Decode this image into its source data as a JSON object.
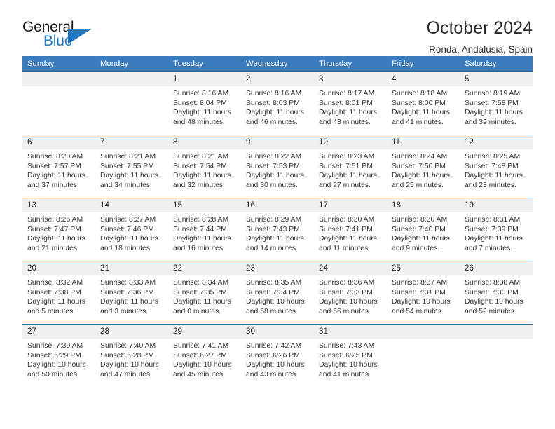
{
  "logo": {
    "word_top": "General",
    "word_bottom": "Blue",
    "triangle_icon": "triangle-icon",
    "accent_color": "#1f78c1"
  },
  "header": {
    "title": "October 2024",
    "subtitle": "Ronda, Andalusia, Spain"
  },
  "theme": {
    "header_blue": "#3a7cbe",
    "border_blue": "#2e6da4",
    "daynum_bg": "#f0f0f0"
  },
  "weekday_headers": [
    "Sunday",
    "Monday",
    "Tuesday",
    "Wednesday",
    "Thursday",
    "Friday",
    "Saturday"
  ],
  "weeks": [
    [
      {
        "day": "",
        "sunrise": "",
        "sunset": "",
        "daylight_line1": "",
        "daylight_line2": ""
      },
      {
        "day": "",
        "sunrise": "",
        "sunset": "",
        "daylight_line1": "",
        "daylight_line2": ""
      },
      {
        "day": "1",
        "sunrise": "Sunrise: 8:16 AM",
        "sunset": "Sunset: 8:04 PM",
        "daylight_line1": "Daylight: 11 hours",
        "daylight_line2": "and 48 minutes."
      },
      {
        "day": "2",
        "sunrise": "Sunrise: 8:16 AM",
        "sunset": "Sunset: 8:03 PM",
        "daylight_line1": "Daylight: 11 hours",
        "daylight_line2": "and 46 minutes."
      },
      {
        "day": "3",
        "sunrise": "Sunrise: 8:17 AM",
        "sunset": "Sunset: 8:01 PM",
        "daylight_line1": "Daylight: 11 hours",
        "daylight_line2": "and 43 minutes."
      },
      {
        "day": "4",
        "sunrise": "Sunrise: 8:18 AM",
        "sunset": "Sunset: 8:00 PM",
        "daylight_line1": "Daylight: 11 hours",
        "daylight_line2": "and 41 minutes."
      },
      {
        "day": "5",
        "sunrise": "Sunrise: 8:19 AM",
        "sunset": "Sunset: 7:58 PM",
        "daylight_line1": "Daylight: 11 hours",
        "daylight_line2": "and 39 minutes."
      }
    ],
    [
      {
        "day": "6",
        "sunrise": "Sunrise: 8:20 AM",
        "sunset": "Sunset: 7:57 PM",
        "daylight_line1": "Daylight: 11 hours",
        "daylight_line2": "and 37 minutes."
      },
      {
        "day": "7",
        "sunrise": "Sunrise: 8:21 AM",
        "sunset": "Sunset: 7:55 PM",
        "daylight_line1": "Daylight: 11 hours",
        "daylight_line2": "and 34 minutes."
      },
      {
        "day": "8",
        "sunrise": "Sunrise: 8:21 AM",
        "sunset": "Sunset: 7:54 PM",
        "daylight_line1": "Daylight: 11 hours",
        "daylight_line2": "and 32 minutes."
      },
      {
        "day": "9",
        "sunrise": "Sunrise: 8:22 AM",
        "sunset": "Sunset: 7:53 PM",
        "daylight_line1": "Daylight: 11 hours",
        "daylight_line2": "and 30 minutes."
      },
      {
        "day": "10",
        "sunrise": "Sunrise: 8:23 AM",
        "sunset": "Sunset: 7:51 PM",
        "daylight_line1": "Daylight: 11 hours",
        "daylight_line2": "and 27 minutes."
      },
      {
        "day": "11",
        "sunrise": "Sunrise: 8:24 AM",
        "sunset": "Sunset: 7:50 PM",
        "daylight_line1": "Daylight: 11 hours",
        "daylight_line2": "and 25 minutes."
      },
      {
        "day": "12",
        "sunrise": "Sunrise: 8:25 AM",
        "sunset": "Sunset: 7:48 PM",
        "daylight_line1": "Daylight: 11 hours",
        "daylight_line2": "and 23 minutes."
      }
    ],
    [
      {
        "day": "13",
        "sunrise": "Sunrise: 8:26 AM",
        "sunset": "Sunset: 7:47 PM",
        "daylight_line1": "Daylight: 11 hours",
        "daylight_line2": "and 21 minutes."
      },
      {
        "day": "14",
        "sunrise": "Sunrise: 8:27 AM",
        "sunset": "Sunset: 7:46 PM",
        "daylight_line1": "Daylight: 11 hours",
        "daylight_line2": "and 18 minutes."
      },
      {
        "day": "15",
        "sunrise": "Sunrise: 8:28 AM",
        "sunset": "Sunset: 7:44 PM",
        "daylight_line1": "Daylight: 11 hours",
        "daylight_line2": "and 16 minutes."
      },
      {
        "day": "16",
        "sunrise": "Sunrise: 8:29 AM",
        "sunset": "Sunset: 7:43 PM",
        "daylight_line1": "Daylight: 11 hours",
        "daylight_line2": "and 14 minutes."
      },
      {
        "day": "17",
        "sunrise": "Sunrise: 8:30 AM",
        "sunset": "Sunset: 7:41 PM",
        "daylight_line1": "Daylight: 11 hours",
        "daylight_line2": "and 11 minutes."
      },
      {
        "day": "18",
        "sunrise": "Sunrise: 8:30 AM",
        "sunset": "Sunset: 7:40 PM",
        "daylight_line1": "Daylight: 11 hours",
        "daylight_line2": "and 9 minutes."
      },
      {
        "day": "19",
        "sunrise": "Sunrise: 8:31 AM",
        "sunset": "Sunset: 7:39 PM",
        "daylight_line1": "Daylight: 11 hours",
        "daylight_line2": "and 7 minutes."
      }
    ],
    [
      {
        "day": "20",
        "sunrise": "Sunrise: 8:32 AM",
        "sunset": "Sunset: 7:38 PM",
        "daylight_line1": "Daylight: 11 hours",
        "daylight_line2": "and 5 minutes."
      },
      {
        "day": "21",
        "sunrise": "Sunrise: 8:33 AM",
        "sunset": "Sunset: 7:36 PM",
        "daylight_line1": "Daylight: 11 hours",
        "daylight_line2": "and 3 minutes."
      },
      {
        "day": "22",
        "sunrise": "Sunrise: 8:34 AM",
        "sunset": "Sunset: 7:35 PM",
        "daylight_line1": "Daylight: 11 hours",
        "daylight_line2": "and 0 minutes."
      },
      {
        "day": "23",
        "sunrise": "Sunrise: 8:35 AM",
        "sunset": "Sunset: 7:34 PM",
        "daylight_line1": "Daylight: 10 hours",
        "daylight_line2": "and 58 minutes."
      },
      {
        "day": "24",
        "sunrise": "Sunrise: 8:36 AM",
        "sunset": "Sunset: 7:33 PM",
        "daylight_line1": "Daylight: 10 hours",
        "daylight_line2": "and 56 minutes."
      },
      {
        "day": "25",
        "sunrise": "Sunrise: 8:37 AM",
        "sunset": "Sunset: 7:31 PM",
        "daylight_line1": "Daylight: 10 hours",
        "daylight_line2": "and 54 minutes."
      },
      {
        "day": "26",
        "sunrise": "Sunrise: 8:38 AM",
        "sunset": "Sunset: 7:30 PM",
        "daylight_line1": "Daylight: 10 hours",
        "daylight_line2": "and 52 minutes."
      }
    ],
    [
      {
        "day": "27",
        "sunrise": "Sunrise: 7:39 AM",
        "sunset": "Sunset: 6:29 PM",
        "daylight_line1": "Daylight: 10 hours",
        "daylight_line2": "and 50 minutes."
      },
      {
        "day": "28",
        "sunrise": "Sunrise: 7:40 AM",
        "sunset": "Sunset: 6:28 PM",
        "daylight_line1": "Daylight: 10 hours",
        "daylight_line2": "and 47 minutes."
      },
      {
        "day": "29",
        "sunrise": "Sunrise: 7:41 AM",
        "sunset": "Sunset: 6:27 PM",
        "daylight_line1": "Daylight: 10 hours",
        "daylight_line2": "and 45 minutes."
      },
      {
        "day": "30",
        "sunrise": "Sunrise: 7:42 AM",
        "sunset": "Sunset: 6:26 PM",
        "daylight_line1": "Daylight: 10 hours",
        "daylight_line2": "and 43 minutes."
      },
      {
        "day": "31",
        "sunrise": "Sunrise: 7:43 AM",
        "sunset": "Sunset: 6:25 PM",
        "daylight_line1": "Daylight: 10 hours",
        "daylight_line2": "and 41 minutes."
      },
      {
        "day": "",
        "sunrise": "",
        "sunset": "",
        "daylight_line1": "",
        "daylight_line2": ""
      },
      {
        "day": "",
        "sunrise": "",
        "sunset": "",
        "daylight_line1": "",
        "daylight_line2": ""
      }
    ]
  ]
}
